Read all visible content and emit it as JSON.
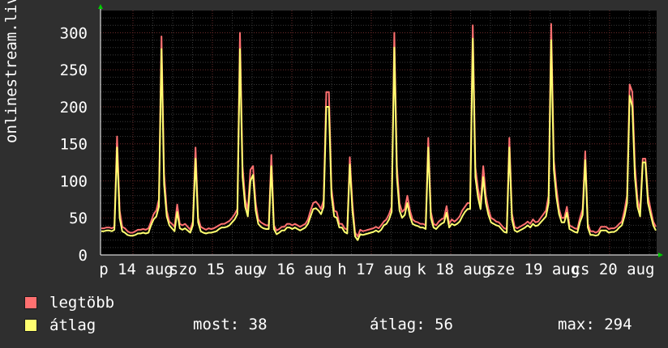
{
  "chart_data": {
    "type": "line",
    "ylabel": "onlinestream.live",
    "ylim": [
      0,
      330
    ],
    "yticks": [
      0,
      50,
      100,
      150,
      200,
      250,
      300
    ],
    "xtick_labels": [
      "p 14 aug",
      "szo 15 aug",
      "v 16 aug",
      "h 17 aug",
      "k 18 aug",
      "sze 19 aug",
      "cs 20 aug"
    ],
    "grid": true,
    "colors": {
      "background": "#2f2f2f",
      "plot": "#000000",
      "grid_minor": "#3a3a3a",
      "grid_major": "#6a2a2a",
      "max_line": "#ff7070",
      "avg_line": "#ffff70",
      "axis_arrow": "#00cc00"
    },
    "series": [
      {
        "name": "legtöbb",
        "color": "#ff7070",
        "values": [
          36,
          36,
          37,
          37,
          36,
          38,
          160,
          60,
          38,
          36,
          32,
          30,
          30,
          32,
          34,
          34,
          35,
          34,
          36,
          45,
          55,
          60,
          75,
          295,
          110,
          60,
          45,
          42,
          38,
          68,
          42,
          40,
          42,
          38,
          34,
          45,
          145,
          50,
          38,
          36,
          34,
          36,
          35,
          36,
          38,
          40,
          42,
          42,
          44,
          46,
          50,
          55,
          62,
          300,
          120,
          75,
          60,
          115,
          120,
          70,
          48,
          44,
          42,
          40,
          40,
          135,
          40,
          33,
          35,
          38,
          38,
          42,
          42,
          40,
          42,
          40,
          38,
          40,
          42,
          48,
          60,
          70,
          72,
          68,
          62,
          74,
          220,
          220,
          90,
          60,
          58,
          42,
          42,
          36,
          34,
          132,
          70,
          30,
          25,
          34,
          32,
          33,
          34,
          35,
          36,
          38,
          36,
          40,
          45,
          48,
          55,
          65,
          300,
          120,
          70,
          58,
          62,
          80,
          60,
          48,
          45,
          44,
          42,
          42,
          40,
          158,
          58,
          42,
          40,
          45,
          48,
          50,
          66,
          42,
          48,
          45,
          48,
          52,
          60,
          65,
          70,
          70,
          310,
          118,
          90,
          70,
          120,
          80,
          62,
          50,
          48,
          45,
          44,
          40,
          36,
          35,
          158,
          56,
          38,
          36,
          38,
          40,
          42,
          45,
          42,
          48,
          44,
          45,
          50,
          55,
          60,
          80,
          312,
          128,
          90,
          62,
          50,
          50,
          65,
          40,
          38,
          36,
          35,
          50,
          62,
          140,
          42,
          32,
          32,
          30,
          32,
          38,
          38,
          38,
          35,
          36,
          36,
          38,
          42,
          45,
          60,
          80,
          230,
          220,
          120,
          75,
          60,
          130,
          130,
          80,
          62,
          45,
          38
        ]
      },
      {
        "name": "átlag",
        "color": "#ffff70",
        "values": [
          32,
          32,
          33,
          33,
          32,
          34,
          145,
          50,
          32,
          30,
          27,
          26,
          26,
          27,
          29,
          29,
          30,
          29,
          30,
          40,
          48,
          52,
          65,
          278,
          95,
          52,
          40,
          36,
          32,
          58,
          36,
          34,
          36,
          33,
          30,
          40,
          130,
          44,
          32,
          30,
          29,
          30,
          30,
          31,
          32,
          35,
          37,
          37,
          38,
          40,
          44,
          48,
          55,
          278,
          105,
          65,
          52,
          100,
          108,
          60,
          42,
          38,
          36,
          35,
          35,
          120,
          35,
          28,
          30,
          33,
          33,
          37,
          37,
          35,
          37,
          35,
          33,
          35,
          37,
          42,
          52,
          62,
          63,
          60,
          55,
          65,
          200,
          200,
          80,
          52,
          50,
          37,
          37,
          31,
          29,
          122,
          60,
          25,
          20,
          28,
          27,
          28,
          29,
          30,
          31,
          33,
          31,
          34,
          40,
          42,
          48,
          58,
          280,
          105,
          60,
          50,
          54,
          70,
          52,
          42,
          40,
          39,
          37,
          37,
          35,
          145,
          50,
          37,
          35,
          39,
          42,
          44,
          57,
          37,
          42,
          40,
          42,
          45,
          52,
          58,
          62,
          62,
          292,
          105,
          78,
          62,
          105,
          70,
          54,
          44,
          42,
          40,
          39,
          35,
          31,
          30,
          145,
          48,
          33,
          31,
          33,
          35,
          37,
          40,
          37,
          42,
          39,
          40,
          44,
          48,
          52,
          70,
          290,
          115,
          78,
          55,
          44,
          44,
          57,
          35,
          33,
          31,
          30,
          44,
          54,
          128,
          37,
          27,
          27,
          26,
          27,
          33,
          33,
          33,
          30,
          31,
          31,
          33,
          37,
          40,
          52,
          70,
          215,
          200,
          105,
          65,
          52,
          125,
          125,
          70,
          55,
          40,
          33
        ]
      }
    ]
  },
  "legend": {
    "max_label": "legtöbb",
    "avg_label": "átlag",
    "stat_current": "most: 38",
    "stat_average": "átlag: 56",
    "stat_max": "max: 294"
  }
}
